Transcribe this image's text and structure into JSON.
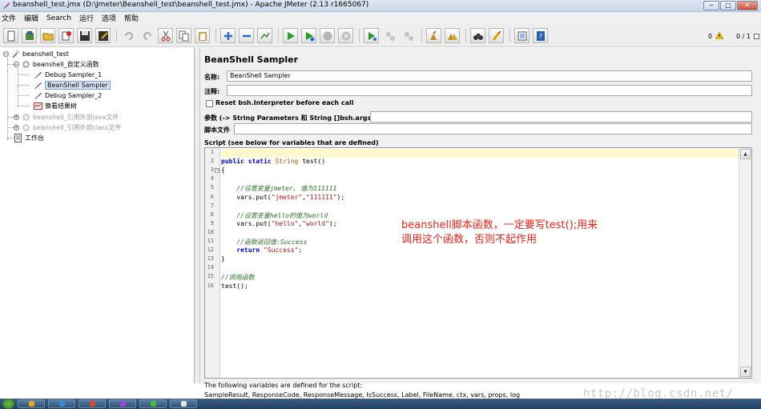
{
  "window": {
    "title": "beanshell_test.jmx (D:\\Jmeter\\Beanshell_test\\beanshell_test.jmx) - Apache JMeter (2.13 r1665067)",
    "minimize": "−",
    "maximize": "□",
    "close": "✕"
  },
  "menu": [
    "文件",
    "编辑",
    "Search",
    "运行",
    "选项",
    "帮助"
  ],
  "toolbar": {
    "warnings": "0",
    "threads": "0 / 1"
  },
  "tree": {
    "root": "beanshell_test",
    "group": "beanshell_自定义函数",
    "items": [
      "Debug Sampler_1",
      "BeanShell Sampler",
      "Debug Sampler_2",
      "察看结果树"
    ],
    "disabled1": "beanshell_引用外部java文件",
    "disabled2": "beanshell_引用外部class文件",
    "workbench": "工作台"
  },
  "sampler": {
    "title": "BeanShell Sampler",
    "name_label": "名称:",
    "name_value": "BeanShell Sampler",
    "comment_label": "注释:",
    "comment_value": "",
    "reset_label": "Reset bsh.Interpreter before each call",
    "reset_checked": false,
    "params_label": "参数 (-> String Parameters 和 String []bsh.args)",
    "params_value": "",
    "scriptfile_label": "脚本文件",
    "scriptfile_value": "",
    "script_header": "Script (see below for variables that are defined)"
  },
  "script": {
    "lines": [
      "",
      "public static String test()",
      "{",
      "",
      "    //设置变量jmeter, 值为111111",
      "    vars.put(\"jmeter\",\"111111\");",
      "",
      "    //设置变量hello的值为world",
      "    vars.put(\"hello\",\"world\");",
      "",
      "    //函数返回值:Success",
      "    return \"Success\";",
      "}",
      "",
      "//调用函数",
      "test();"
    ],
    "line_numbers": [
      "1",
      "2",
      "3",
      "4",
      "5",
      "6",
      "7",
      "8",
      "9",
      "10",
      "11",
      "12",
      "13",
      "14",
      "15",
      "16"
    ]
  },
  "annotation": {
    "line1": "beanshell脚本函数，一定要写test();用来",
    "line2": "调用这个函数，否则不起作用"
  },
  "footer": {
    "line1": "The following variables are defined for the script:",
    "line2": "SampleResult, ResponseCode, ResponseMessage, IsSuccess, Label, FileName, ctx, vars, props, log"
  },
  "watermark": "http://blog.csdn.net/",
  "colors": {
    "annotation": "#e8231b",
    "keyword": "#0000c8",
    "comment": "#2f6e2f",
    "string": "#b01010",
    "current_line": "#fffacd"
  }
}
